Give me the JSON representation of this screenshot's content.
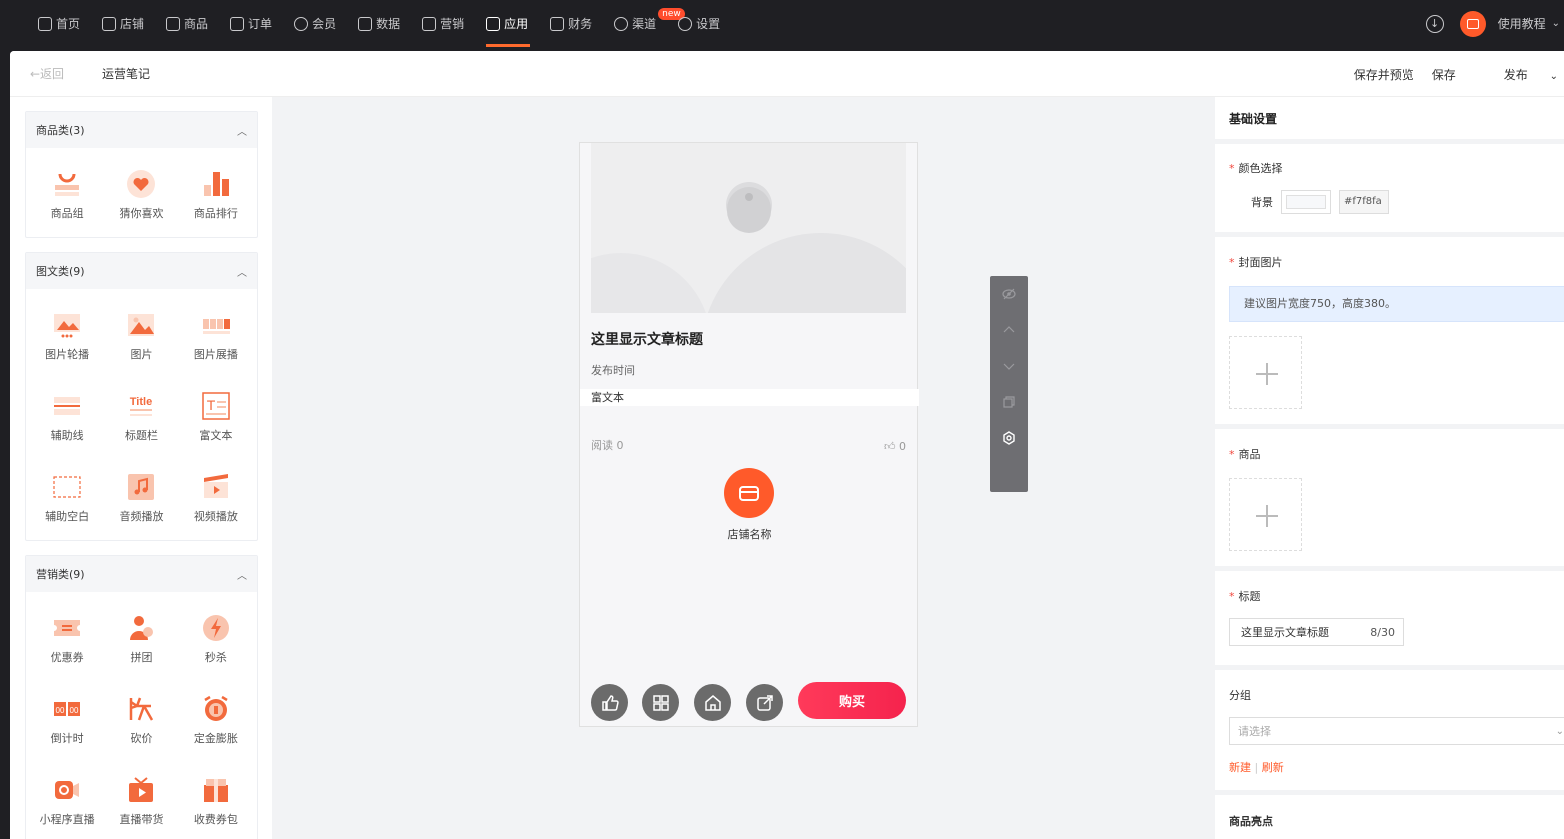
{
  "topnav": {
    "items": [
      {
        "label": "首页",
        "icon": "home-icon"
      },
      {
        "label": "店铺",
        "icon": "store-icon"
      },
      {
        "label": "商品",
        "icon": "goods-icon"
      },
      {
        "label": "订单",
        "icon": "order-icon"
      },
      {
        "label": "会员",
        "icon": "member-icon"
      },
      {
        "label": "数据",
        "icon": "chart-icon"
      },
      {
        "label": "营销",
        "icon": "tag-icon"
      },
      {
        "label": "应用",
        "icon": "app-icon",
        "active": true
      },
      {
        "label": "财务",
        "icon": "finance-icon"
      },
      {
        "label": "渠道",
        "icon": "channel-icon",
        "badge": "new"
      },
      {
        "label": "设置",
        "icon": "gear-icon"
      }
    ],
    "tutorial": "使用教程"
  },
  "subbar": {
    "back": "←返回",
    "title": "运营笔记",
    "save_preview": "保存并预览",
    "save": "保存",
    "publish": "发布"
  },
  "left": {
    "groups": [
      {
        "title": "商品类(3)",
        "items": [
          "商品组",
          "猜你喜欢",
          "商品排行"
        ]
      },
      {
        "title": "图文类(9)",
        "items": [
          "图片轮播",
          "图片",
          "图片展播",
          "辅助线",
          "标题栏",
          "富文本",
          "辅助空白",
          "音频播放",
          "视频播放"
        ]
      },
      {
        "title": "营销类(9)",
        "items": [
          "优惠券",
          "拼团",
          "秒杀",
          "倒计时",
          "砍价",
          "定金膨胀",
          "小程序直播",
          "直播带货",
          "收费券包"
        ]
      }
    ],
    "title_icon_text": "Title"
  },
  "phone": {
    "article_title": "这里显示文章标题",
    "publish_time": "发布时间",
    "rich_text": "富文本",
    "reads": "阅读 0",
    "likes": "0",
    "shop_name": "店铺名称",
    "buy": "购买"
  },
  "right": {
    "header": "基础设置",
    "color_label": "颜色选择",
    "bg_label": "背景",
    "bg_value": "#f7f8fa",
    "cover_label": "封面图片",
    "cover_tip": "建议图片宽度750，高度380。",
    "goods_label": "商品",
    "title_label": "标题",
    "title_value": "这里显示文章标题",
    "title_count": "8/30",
    "group_label": "分组",
    "group_placeholder": "请选择",
    "new_link": "新建",
    "refresh_link": "刷新",
    "highlight_label": "商品亮点"
  },
  "colors": {
    "accent": "#ff5a2a",
    "buy": "#f5234d",
    "tip_bg": "#e6f0ff"
  }
}
